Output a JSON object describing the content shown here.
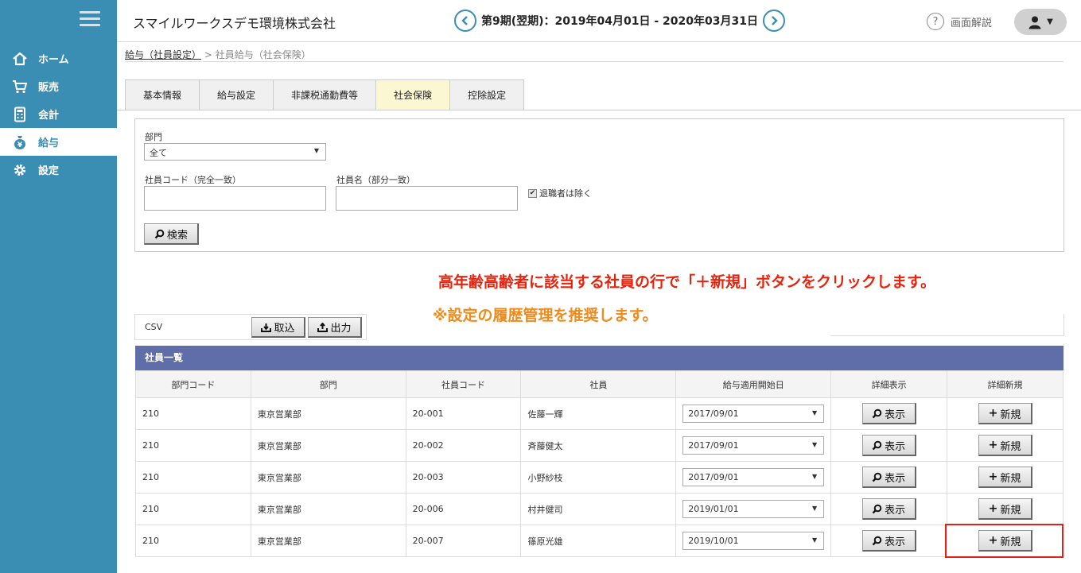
{
  "sidebar": {
    "items": [
      {
        "label": "ホーム",
        "icon": "home-icon"
      },
      {
        "label": "販売",
        "icon": "cart-icon"
      },
      {
        "label": "会計",
        "icon": "calculator-icon"
      },
      {
        "label": "給与",
        "icon": "money-bag-icon"
      },
      {
        "label": "設定",
        "icon": "gear-icon"
      }
    ],
    "active_index": 3
  },
  "header": {
    "company": "スマイルワークスデモ環境株式会社",
    "period": "第9期(翌期)：2019年04月01日 - 2020年03月31日",
    "help_label": "画面解説"
  },
  "breadcrumb": {
    "parent": "給与（社員設定）",
    "separator": ">",
    "current": "社員給与（社会保険）"
  },
  "tabs": [
    "基本情報",
    "給与設定",
    "非課税通勤費等",
    "社会保険",
    "控除設定"
  ],
  "active_tab": 3,
  "search": {
    "dept_label": "部門",
    "dept_value": "全て",
    "code_label": "社員コード（完全一致）",
    "code_value": "",
    "name_label": "社員名（部分一致）",
    "name_value": "",
    "exclude_label": "退職者は除く",
    "exclude_checked": true,
    "search_button": "検索"
  },
  "annotation": {
    "line1": "高年齢高齢者に該当する社員の行で「＋新規」ボタンをクリックします。",
    "line2": "※設定の履歴管理を推奨します。"
  },
  "csv": {
    "label": "CSV",
    "import_button": "取込",
    "export_button": "出力"
  },
  "table": {
    "title": "社員一覧",
    "headers": [
      "部門コード",
      "部門",
      "社員コード",
      "社員",
      "給与適用開始日",
      "詳細表示",
      "詳細新規"
    ],
    "show_button": "表示",
    "new_button": "新規",
    "rows": [
      {
        "dept_code": "210",
        "dept": "東京営業部",
        "emp_code": "20-001",
        "name": "佐藤一輝",
        "start_date": "2017/09/01"
      },
      {
        "dept_code": "210",
        "dept": "東京営業部",
        "emp_code": "20-002",
        "name": "斉藤健太",
        "start_date": "2017/09/01"
      },
      {
        "dept_code": "210",
        "dept": "東京営業部",
        "emp_code": "20-003",
        "name": "小野紗枝",
        "start_date": "2017/09/01"
      },
      {
        "dept_code": "210",
        "dept": "東京営業部",
        "emp_code": "20-006",
        "name": "村井健司",
        "start_date": "2019/01/01"
      },
      {
        "dept_code": "210",
        "dept": "東京営業部",
        "emp_code": "20-007",
        "name": "篠原光雄",
        "start_date": "2019/10/01"
      }
    ]
  },
  "colors": {
    "sidebar_bg": "#3a8db3",
    "table_header_bg": "#5f6ea8",
    "annotation_red": "#e8230d",
    "annotation_orange": "#f08a1a",
    "highlight_border": "#e0221a",
    "active_tab_bg": "#fbf7d2"
  }
}
